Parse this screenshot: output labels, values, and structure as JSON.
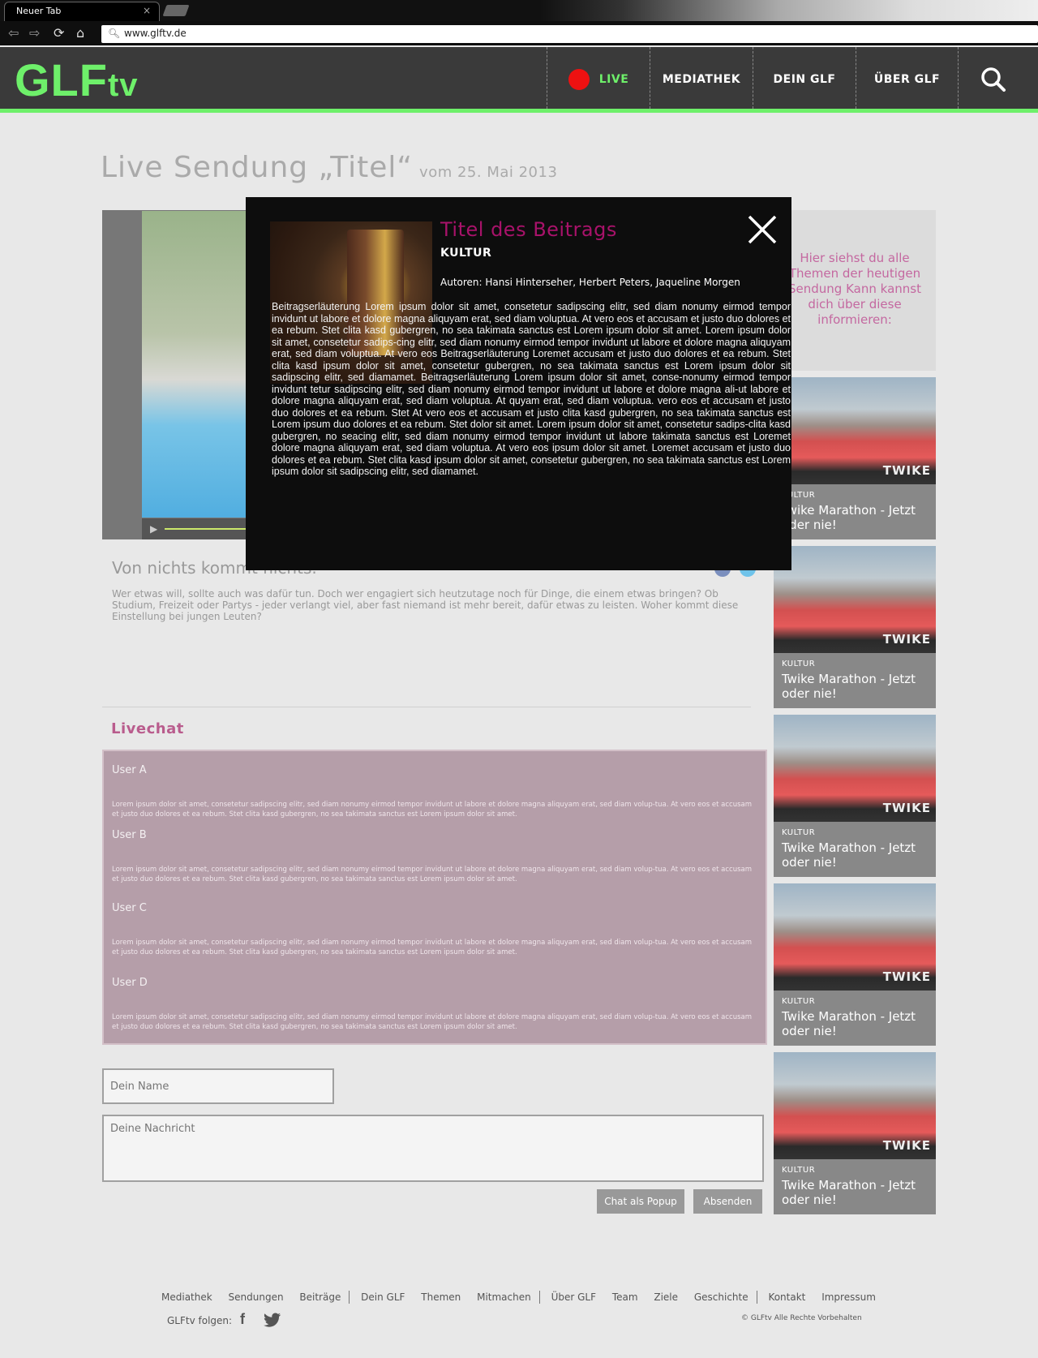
{
  "browser": {
    "tab_title": "Neuer Tab",
    "tab_close": "×",
    "url": "www.glftv.de"
  },
  "header": {
    "logo_main": "GLF",
    "logo_suffix": "tv",
    "nav": [
      {
        "label": "LIVE",
        "accent": "#6ef06a"
      },
      {
        "label": "MEDIATHEK"
      },
      {
        "label": "DEIN GLF"
      },
      {
        "label": "ÜBER GLF"
      }
    ],
    "accent_color": "#6ef06a"
  },
  "page": {
    "title": "Live Sendung „Titel“",
    "date": "vom 25. Mai 2013"
  },
  "article": {
    "title": "Von nichts kommt nichts.",
    "body": "Wer etwas will, sollte auch was dafür tun. Doch wer engagiert sich heutzutage noch für Dinge, die einem etwas bringen? Ob Studium, Freizeit oder Partys - jeder verlangt viel, aber fast niemand ist mehr bereit, dafür etwas zu leisten. Woher kommt diese Einstellung bei jungen Leuten?"
  },
  "livechat": {
    "heading": "Livechat",
    "messages": [
      {
        "user": "User A",
        "text": "Lorem ipsum dolor sit amet, consetetur sadipscing elitr, sed diam nonumy eirmod tempor invidunt ut labore et dolore magna aliquyam erat, sed diam volup-tua. At vero eos et accusam et justo duo dolores et ea rebum. Stet clita kasd gubergren, no sea takimata sanctus est Lorem ipsum dolor sit amet."
      },
      {
        "user": "User B",
        "text": "Lorem ipsum dolor sit amet, consetetur sadipscing elitr, sed diam nonumy eirmod tempor invidunt ut labore et dolore magna aliquyam erat, sed diam volup-tua. At vero eos et accusam et justo duo dolores et ea rebum. Stet clita kasd gubergren, no sea takimata sanctus est Lorem ipsum dolor sit amet."
      },
      {
        "user": "User C",
        "text": "Lorem ipsum dolor sit amet, consetetur sadipscing elitr, sed diam nonumy eirmod tempor invidunt ut labore et dolore magna aliquyam erat, sed diam volup-tua. At vero eos et accusam et justo duo dolores et ea rebum. Stet clita kasd gubergren, no sea takimata sanctus est Lorem ipsum dolor sit amet."
      },
      {
        "user": "User D",
        "text": "Lorem ipsum dolor sit amet, consetetur sadipscing elitr, sed diam nonumy eirmod tempor invidunt ut labore et dolore magna aliquyam erat, sed diam volup-tua. At vero eos et accusam et justo duo dolores et ea rebum. Stet clita kasd gubergren, no sea takimata sanctus est Lorem ipsum dolor sit amet."
      }
    ],
    "name_placeholder": "Dein Name",
    "message_placeholder": "Deine Nachricht",
    "popup_button": "Chat als Popup",
    "send_button": "Absenden"
  },
  "sidebar": {
    "info_text": "Hier siehst du alle Themen der heutigen Sendung Kann kannst dich über diese informieren:",
    "teasers": [
      {
        "category": "KULTUR",
        "title": "Twike Marathon - Jetzt oder nie!",
        "image_label": "TWIKE"
      },
      {
        "category": "KULTUR",
        "title": "Twike Marathon - Jetzt oder nie!",
        "image_label": "TWIKE"
      },
      {
        "category": "KULTUR",
        "title": "Twike Marathon - Jetzt oder nie!",
        "image_label": "TWIKE"
      },
      {
        "category": "KULTUR",
        "title": "Twike Marathon - Jetzt oder nie!",
        "image_label": "TWIKE"
      },
      {
        "category": "KULTUR",
        "title": "Twike Marathon - Jetzt oder nie!",
        "image_label": "TWIKE"
      }
    ]
  },
  "footer": {
    "links": [
      "Mediathek",
      "Sendungen",
      "Beiträge",
      "Dein GLF",
      "Themen",
      "Mitmachen",
      "Über GLF",
      "Team",
      "Ziele",
      "Geschichte",
      "Kontakt",
      "Impressum"
    ],
    "follow_label": "GLFtv folgen:",
    "copyright": "© GLFtv Alle Rechte Vorbehalten"
  },
  "modal": {
    "title": "Titel des Beitrags",
    "category": "KULTUR",
    "authors": "Autoren: Hansi Hinterseher, Herbert Peters, Jaqueline Morgen",
    "body": "Beitragserläuterung Lorem ipsum dolor sit amet, consetetur sadipscing elitr, sed diam nonumy eirmod tempor invidunt ut labore et dolore magna aliquyam erat, sed diam voluptua. At vero eos et accusam et justo duo dolores et ea rebum. Stet clita kasd gubergren, no sea takimata sanctus est Lorem ipsum dolor sit amet. Lorem ipsum dolor sit amet, consetetur sadips-cing elitr, sed diam nonumy eirmod tempor invidunt ut labore et dolore magna aliquyam erat, sed diam voluptua. At vero eos Beitragserläuterung Loremet accusam et justo duo dolores et ea rebum. Stet clita kasd ipsum dolor sit amet, consetetur gubergren, no sea takimata sanctus est Lorem ipsum dolor sit sadipscing elitr, sed diamamet. Beitragserläuterung Lorem ipsum dolor sit amet, conse-nonumy eirmod tempor invidunt tetur sadipscing elitr, sed diam nonumy eirmod tempor invidunt ut labore et dolore magna ali-ut labore et dolore magna aliquyam erat, sed diam voluptua. At quyam erat, sed diam voluptua. vero eos et accusam et justo duo dolores et ea rebum. Stet At vero eos et accusam et justo clita kasd gubergren, no sea takimata sanctus est Lorem ipsum duo dolores et ea rebum. Stet dolor sit amet. Lorem ipsum dolor sit amet, consetetur sadips-clita kasd gubergren, no seacing elitr, sed diam nonumy eirmod tempor invidunt ut labore takimata sanctus est Loremet dolore magna aliquyam erat, sed diam voluptua. At vero eos ipsum dolor sit amet. Loremet accusam et justo duo dolores et ea rebum. Stet clita kasd ipsum dolor sit amet, consetetur gubergren, no sea takimata sanctus est Lorem ipsum dolor sit sadipscing elitr, sed diamamet."
  }
}
